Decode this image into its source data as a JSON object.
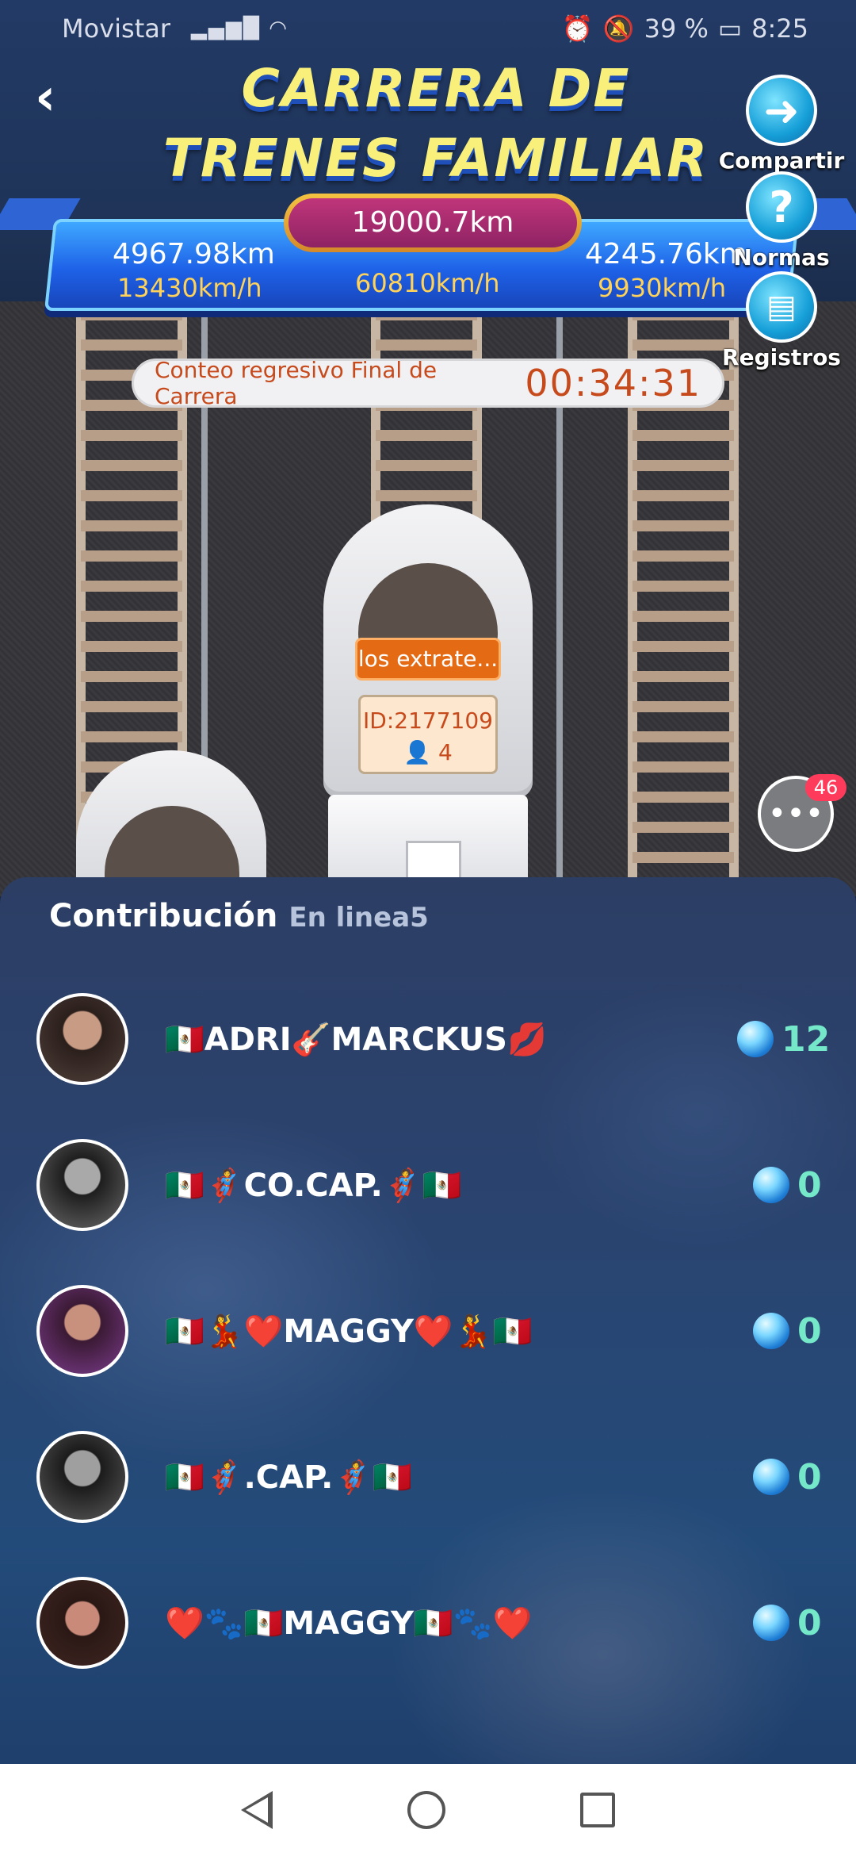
{
  "status_bar": {
    "carrier": "Movistar",
    "battery": "39 %",
    "time": "8:25"
  },
  "header": {
    "title_line1": "CARRERA DE",
    "title_line2": "TRENES FAMILIAR"
  },
  "side_buttons": {
    "share": "Compartir",
    "rules": "Normas",
    "records": "Registros"
  },
  "race": {
    "total_distance": "19000.7km",
    "left": {
      "distance": "4967.98km",
      "speed": "13430km/h"
    },
    "center": {
      "speed": "60810km/h"
    },
    "right": {
      "distance": "4245.76km",
      "speed": "9930km/h"
    },
    "countdown_label": "Conteo regresivo Final de Carrera",
    "countdown_time": "00:34:31"
  },
  "train": {
    "name": "los extrate...",
    "id": "ID:2177109",
    "members": "4"
  },
  "chat": {
    "badge": "46"
  },
  "contribution": {
    "title": "Contribución",
    "subtitle": "En linea5",
    "rows": [
      {
        "name": "🇲🇽ADRI🎸MARCKUS💋",
        "points": "12"
      },
      {
        "name": "🇲🇽🦸CO.CAP.🦸🇲🇽",
        "points": "0"
      },
      {
        "name": "🇲🇽💃❤️MAGGY❤️💃🇲🇽",
        "points": "0"
      },
      {
        "name": "🇲🇽🦸.CAP.🦸🇲🇽",
        "points": "0"
      },
      {
        "name": "❤️🐾🇲🇽MAGGY🇲🇽🐾❤️",
        "points": "0"
      }
    ]
  },
  "colors": {
    "accent_gold": "#f8f07a",
    "points_green": "#74e8c9",
    "countdown_red": "#c74a1c"
  },
  "icons": [
    "back-icon",
    "share-icon",
    "help-icon",
    "records-icon",
    "chat-icon",
    "gem-icon",
    "member-icon"
  ]
}
